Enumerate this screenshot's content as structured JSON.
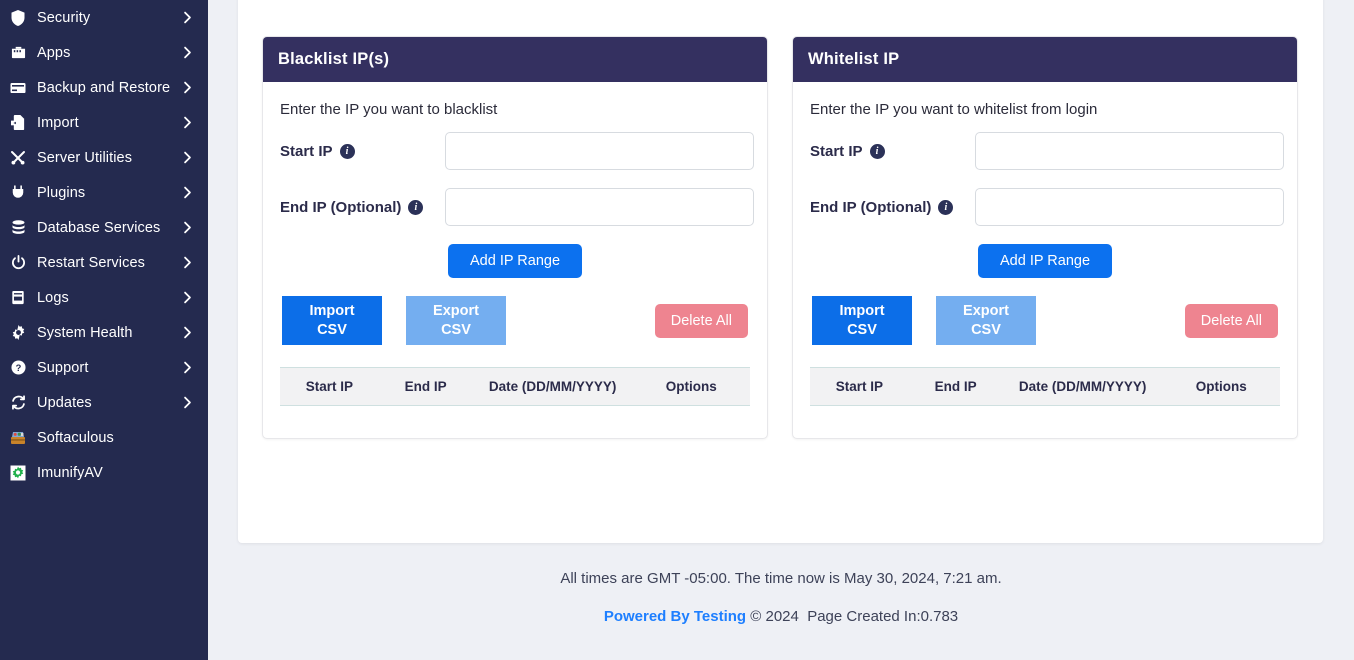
{
  "sidebar": {
    "items": [
      {
        "label": "Security",
        "icon": "shield-icon",
        "chevron": true
      },
      {
        "label": "Apps",
        "icon": "apps-icon",
        "chevron": true
      },
      {
        "label": "Backup and Restore",
        "icon": "backup-icon",
        "chevron": true
      },
      {
        "label": "Import",
        "icon": "import-icon",
        "chevron": true
      },
      {
        "label": "Server Utilities",
        "icon": "tools-icon",
        "chevron": true
      },
      {
        "label": "Plugins",
        "icon": "plug-icon",
        "chevron": true
      },
      {
        "label": "Database Services",
        "icon": "database-icon",
        "chevron": true
      },
      {
        "label": "Restart Services",
        "icon": "power-icon",
        "chevron": true
      },
      {
        "label": "Logs",
        "icon": "logs-icon",
        "chevron": true
      },
      {
        "label": "System Health",
        "icon": "gear-icon",
        "chevron": true
      },
      {
        "label": "Support",
        "icon": "help-icon",
        "chevron": true
      },
      {
        "label": "Updates",
        "icon": "refresh-icon",
        "chevron": true
      },
      {
        "label": "Softaculous",
        "icon": "toolbox-icon",
        "chevron": false
      },
      {
        "label": "ImunifyAV",
        "icon": "imunify-icon",
        "chevron": false
      }
    ]
  },
  "blacklist": {
    "title": "Blacklist IP(s)",
    "description": "Enter the IP you want to blacklist",
    "start_ip_label": "Start IP",
    "start_ip_value": "",
    "end_ip_label": "End IP (Optional)",
    "end_ip_value": "",
    "info_glyph": "i",
    "add_button": "Add IP Range",
    "import_button_line1": "Import",
    "import_button_line2": "CSV",
    "export_button_line1": "Export",
    "export_button_line2": "CSV",
    "delete_button": "Delete All",
    "table": {
      "columns": [
        "Start IP",
        "End IP",
        "Date (DD/MM/YYYY)",
        "Options"
      ],
      "rows": []
    }
  },
  "whitelist": {
    "title": "Whitelist IP",
    "description": "Enter the IP you want to whitelist from login",
    "start_ip_label": "Start IP",
    "start_ip_value": "",
    "end_ip_label": "End IP (Optional)",
    "end_ip_value": "",
    "info_glyph": "i",
    "add_button": "Add IP Range",
    "import_button_line1": "Import",
    "import_button_line2": "CSV",
    "export_button_line1": "Export",
    "export_button_line2": "CSV",
    "delete_button": "Delete All",
    "table": {
      "columns": [
        "Start IP",
        "End IP",
        "Date (DD/MM/YYYY)",
        "Options"
      ],
      "rows": []
    }
  },
  "footer": {
    "times_text": "All times are GMT -05:00. The time now is May 30, 2024, 7:21 am.",
    "powered_by": "Powered By Testing",
    "copyright": "© 2024",
    "page_created": "Page Created In:0.783"
  },
  "colors": {
    "sidebar_bg": "#242a4f",
    "panel_header": "#343060",
    "primary_blue": "#0c71ef",
    "light_blue": "#74aef0",
    "danger": "#ee8490",
    "link_blue": "#1e7fff",
    "page_bg": "#eef0f5"
  }
}
